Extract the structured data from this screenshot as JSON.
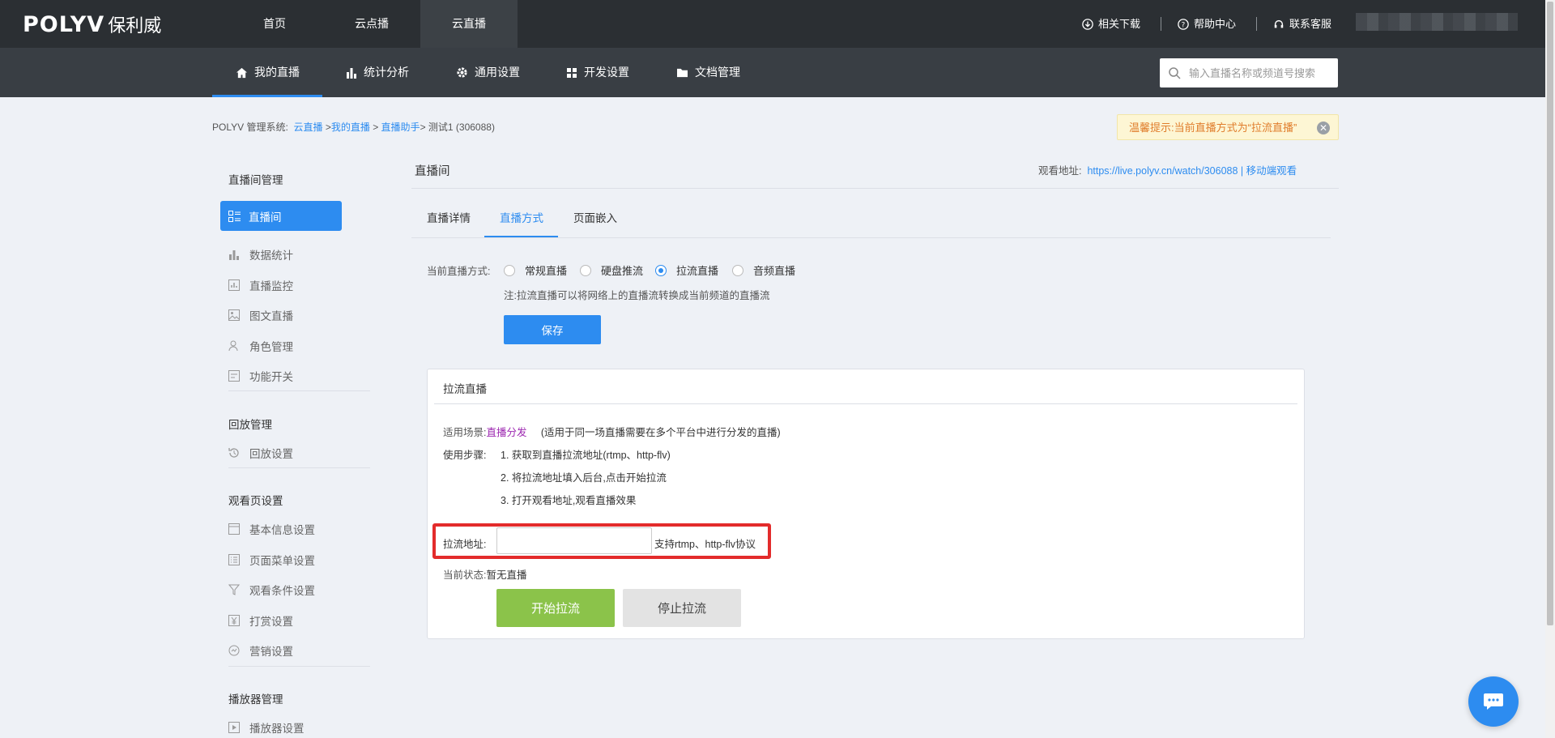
{
  "header": {
    "logo": {
      "brand": "POLYV",
      "cn": "保利威"
    },
    "nav": [
      "首页",
      "云点播",
      "云直播"
    ],
    "active_nav": "云直播",
    "links": {
      "download": "相关下载",
      "help": "帮助中心",
      "support": "联系客服"
    }
  },
  "subnav": {
    "items": [
      "我的直播",
      "统计分析",
      "通用设置",
      "开发设置",
      "文档管理"
    ],
    "active": "我的直播",
    "search_placeholder": "输入直播名称或频道号搜索"
  },
  "breadcrumb": {
    "prefix": "POLYV 管理系统:",
    "items": [
      "云直播",
      "我的直播",
      "直播助手"
    ],
    "sep1": " >",
    "sep2": " > ",
    "sep3": "> ",
    "current": "测试1 (306088)"
  },
  "tip": {
    "text": "温馨提示:当前直播方式为“拉流直播”"
  },
  "sidebar": {
    "group1": "直播间管理",
    "items1": [
      "直播间",
      "数据统计",
      "直播监控",
      "图文直播",
      "角色管理",
      "功能开关"
    ],
    "group2": "回放管理",
    "items2": [
      "回放设置"
    ],
    "group3": "观看页设置",
    "items3": [
      "基本信息设置",
      "页面菜单设置",
      "观看条件设置",
      "打赏设置",
      "营销设置"
    ],
    "group4": "播放器管理",
    "items4": [
      "播放器设置"
    ]
  },
  "main": {
    "title": "直播间",
    "watch_label": "观看地址:",
    "watch_url": "https://live.polyv.cn/watch/306088",
    "watch_sep": "|",
    "mobile_watch": "移动端观看",
    "tabs": [
      "直播详情",
      "直播方式",
      "页面嵌入"
    ],
    "active_tab": "直播方式",
    "mode_label": "当前直播方式:",
    "modes": [
      "常规直播",
      "硬盘推流",
      "拉流直播",
      "音频直播"
    ],
    "selected_mode": "拉流直播",
    "note": "注:拉流直播可以将网络上的直播流转换成当前频道的直播流",
    "save": "保存"
  },
  "panel": {
    "title": "拉流直播",
    "scene_label": "适用场景:",
    "scene_value": "直播分发",
    "scene_desc": "(适用于同一场直播需要在多个平台中进行分发的直播)",
    "steps_label": "使用步骤:",
    "steps": [
      "1. 获取到直播拉流地址(rtmp、http-flv)",
      "2. 将拉流地址填入后台,点击开始拉流",
      "3. 打开观看地址,观看直播效果"
    ],
    "address_label": "拉流地址:",
    "address_value": "",
    "address_hint": "支持rtmp、http-flv协议",
    "status_label": "当前状态:",
    "status_value": "暂无直播",
    "start": "开始拉流",
    "stop": "停止拉流"
  },
  "colors": {
    "primary": "#2d8cf0",
    "topbar": "#2b2f33",
    "subbar": "#393e44",
    "start_button": "#8bc34a",
    "highlight": "#e32b2b",
    "scene_value": "#9c27b0"
  }
}
